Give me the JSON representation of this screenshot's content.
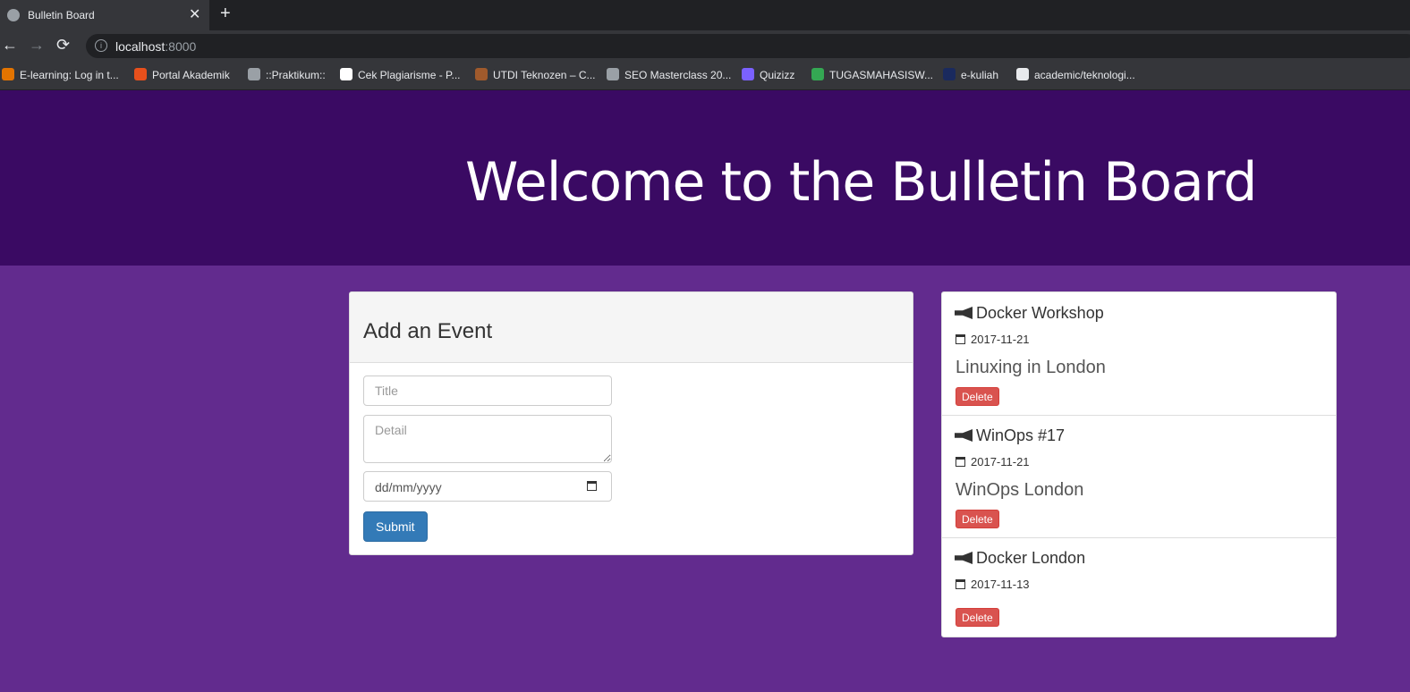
{
  "browser": {
    "tab_title": "Bulletin Board",
    "url_host": "localhost",
    "url_port": ":8000",
    "bookmarks": [
      {
        "label": "E-learning: Log in t...",
        "color": "#e37400"
      },
      {
        "label": "Portal Akademik",
        "color": "#e8501c"
      },
      {
        "label": "::Praktikum::",
        "color": "#9aa0a6"
      },
      {
        "label": "Cek Plagiarisme - P...",
        "color": "#ffffff"
      },
      {
        "label": "UTDI Teknozen – C...",
        "color": "#a05a2c"
      },
      {
        "label": "SEO Masterclass 20...",
        "color": "#9aa0a6"
      },
      {
        "label": "Quizizz",
        "color": "#7b61ff"
      },
      {
        "label": "TUGASMAHASISW...",
        "color": "#34a853"
      },
      {
        "label": "e-kuliah",
        "color": "#1a2a5e"
      },
      {
        "label": "academic/teknologi...",
        "color": "#e8eaed"
      }
    ]
  },
  "hero": {
    "title": "Welcome to the Bulletin Board"
  },
  "form": {
    "heading": "Add an Event",
    "title_placeholder": "Title",
    "detail_placeholder": "Detail",
    "date_placeholder": "dd/mm/yyyy",
    "submit_label": "Submit"
  },
  "events": [
    {
      "title": "Docker Workshop",
      "date": "2017-11-21",
      "detail": "Linuxing in London",
      "delete_label": "Delete"
    },
    {
      "title": "WinOps #17",
      "date": "2017-11-21",
      "detail": "WinOps London",
      "delete_label": "Delete"
    },
    {
      "title": "Docker London",
      "date": "2017-11-13",
      "detail": "",
      "delete_label": "Delete"
    }
  ],
  "colors": {
    "hero_bg": "#3a0a63",
    "page_bg": "#622b8e",
    "primary": "#337ab7",
    "danger": "#d9534f"
  }
}
